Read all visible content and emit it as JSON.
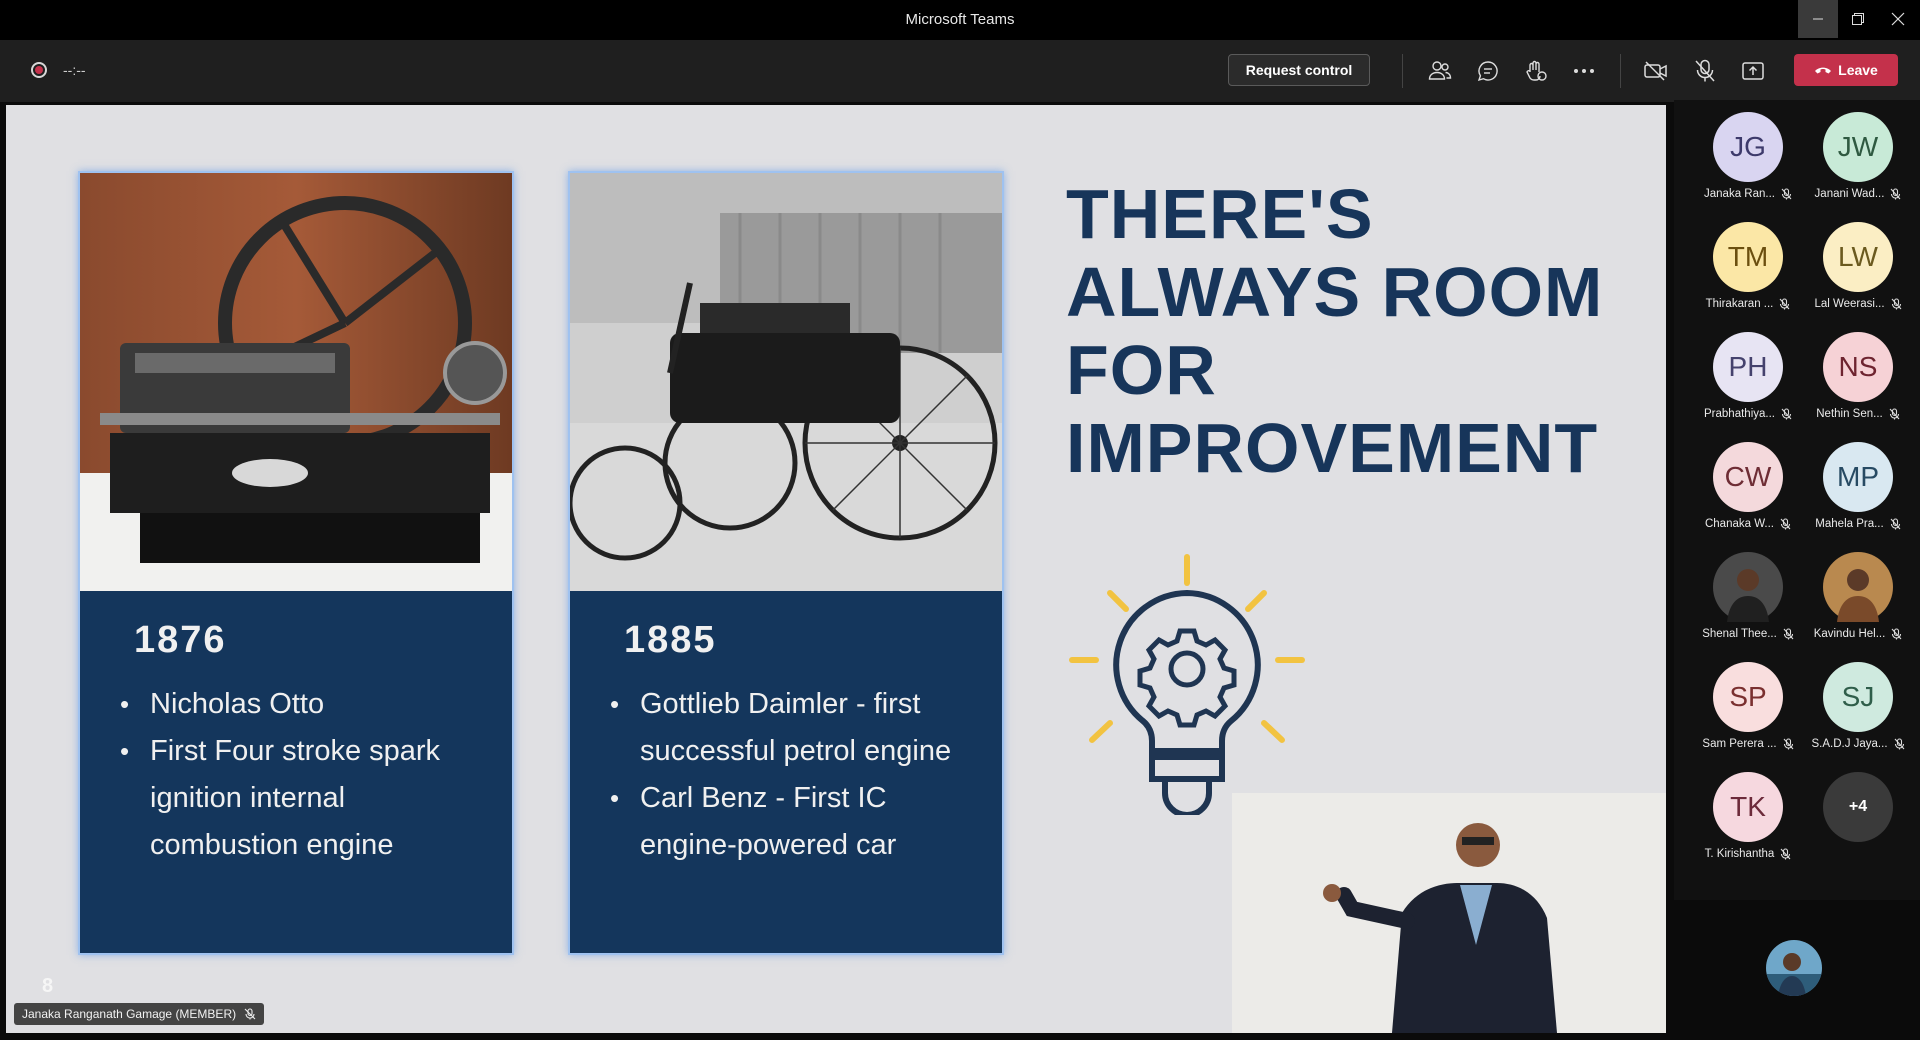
{
  "window": {
    "title": "Microsoft Teams"
  },
  "toolbar": {
    "recording_timer": "--:--",
    "request_control_label": "Request control",
    "leave_label": "Leave"
  },
  "slide": {
    "cards": [
      {
        "year": "1876",
        "bullets": [
          "Nicholas Otto",
          "First Four stroke spark ignition internal combustion engine"
        ]
      },
      {
        "year": "1885",
        "bullets": [
          "Gottlieb Daimler - first successful petrol engine",
          "Carl Benz - First IC engine-powered car"
        ]
      }
    ],
    "headline": [
      "THERE'S",
      "ALWAYS ROOM",
      "FOR",
      "IMPROVEMENT"
    ],
    "slide_number": "8"
  },
  "presenter_tag": "Janaka Ranganath Gamage (MEMBER)",
  "participants": [
    {
      "initials": "JG",
      "name": "Janaka Ran...",
      "color": "#d9d5f1",
      "text": "#3d3a6b"
    },
    {
      "initials": "JW",
      "name": "Janani Wad...",
      "color": "#c8ead7",
      "text": "#2f5a41"
    },
    {
      "initials": "TM",
      "name": "Thirakaran ...",
      "color": "#fbe7a6",
      "text": "#6b4f0f"
    },
    {
      "initials": "LW",
      "name": "Lal Weerasi...",
      "color": "#fbeec4",
      "text": "#6b5a1f"
    },
    {
      "initials": "PH",
      "name": "Prabhathiya...",
      "color": "#e7e4f3",
      "text": "#45426d"
    },
    {
      "initials": "NS",
      "name": "Nethin Sen...",
      "color": "#f6d2d6",
      "text": "#6e2430"
    },
    {
      "initials": "CW",
      "name": "Chanaka W...",
      "color": "#f4d9dc",
      "text": "#6e2d35"
    },
    {
      "initials": "MP",
      "name": "Mahela Pra...",
      "color": "#d9e8f1",
      "text": "#274a63"
    },
    {
      "initials": "",
      "name": "Shenal Thee...",
      "color": "#4a4a4a",
      "text": "#fff"
    },
    {
      "initials": "",
      "name": "Kavindu Hel...",
      "color": "#b9894f",
      "text": "#fff"
    },
    {
      "initials": "SP",
      "name": "Sam Perera ...",
      "color": "#f9dede",
      "text": "#7a2f2f"
    },
    {
      "initials": "SJ",
      "name": "S.A.D.J Jaya...",
      "color": "#cfeadf",
      "text": "#2f5e4a"
    },
    {
      "initials": "TK",
      "name": "T. Kirishantha",
      "color": "#f6d8df",
      "text": "#6c2a3a"
    }
  ],
  "more_participants": "+4"
}
